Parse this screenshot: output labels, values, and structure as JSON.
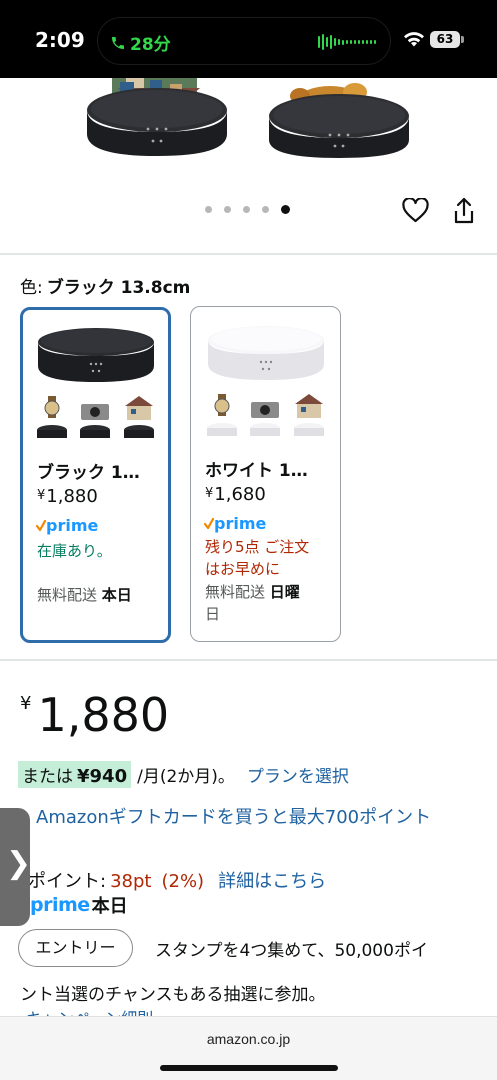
{
  "status_bar": {
    "time": "2:09",
    "call_duration": "28分",
    "battery": "63"
  },
  "carousel": {
    "total_dots": 5,
    "active_index": 4
  },
  "color_selector": {
    "label": "色:",
    "selected_value": "ブラック 13.8cm"
  },
  "variants": [
    {
      "name": "ブラック 1…",
      "price_symbol": "¥",
      "price": "1,880",
      "prime": "prime",
      "stock_lines": [
        "在庫あり。"
      ],
      "shipping_label": "無料配送",
      "shipping_day": "本日",
      "color": "#1f2023"
    },
    {
      "name": "ホワイト 1…",
      "price_symbol": "¥",
      "price": "1,680",
      "prime": "prime",
      "stock_lines": [
        "残り5点 ご注文",
        "はお早めに"
      ],
      "shipping_label": "無料配送",
      "shipping_day_line1": "日曜",
      "shipping_day_line2": "日",
      "color": "#f2f2f4"
    }
  ],
  "price": {
    "symbol": "¥",
    "amount": "1,880"
  },
  "installment": {
    "prefix": "または",
    "amount": "¥940",
    "term": "/月(2か月)。",
    "plan_link": "プランを選択"
  },
  "gift_card_link": "Amazonギフトカードを買うと最大700ポイント",
  "points": {
    "label": "ポイント:",
    "value": "38pt",
    "percent": "(2%)",
    "details_link": "詳細はこちら"
  },
  "prime_delivery": {
    "prime": "prime",
    "day": "本日"
  },
  "side_tab_glyph": "❯",
  "entry": {
    "button_label": "エントリー",
    "text_line1": "スタンプを4つ集めて、50,000ポイ",
    "text_line2": "ント当選のチャンスもある抽選に参加。",
    "campaign_link": "キャンペーン細則 ›"
  },
  "browser": {
    "url": "amazon.co.jp"
  },
  "colors": {
    "link": "#2162a1",
    "selected_border": "#2e6cab",
    "in_stock": "#067d62",
    "deal_red": "#b12704",
    "prime_blue": "#1a98ff",
    "installment_bg": "#c4eed8"
  }
}
